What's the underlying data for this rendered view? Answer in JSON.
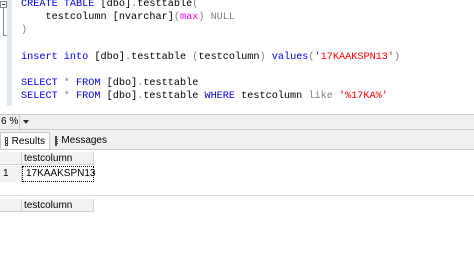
{
  "editor": {
    "lines": [
      {
        "parts": [
          {
            "t": "CREATE TABLE ",
            "c": "kw"
          },
          {
            "t": "[dbo]",
            "c": ""
          },
          {
            "t": ".",
            "c": "op"
          },
          {
            "t": "testtable",
            "c": ""
          },
          {
            "t": "(",
            "c": "op"
          }
        ]
      },
      {
        "parts": [
          {
            "t": "    testcolumn ",
            "c": ""
          },
          {
            "t": "[nvarchar]",
            "c": ""
          },
          {
            "t": "(",
            "c": "op"
          },
          {
            "t": "max",
            "c": "fn"
          },
          {
            "t": ")",
            "c": "op"
          },
          {
            "t": " ",
            "c": ""
          },
          {
            "t": "NULL",
            "c": "op"
          }
        ]
      },
      {
        "parts": [
          {
            "t": ")",
            "c": "op"
          }
        ]
      },
      {
        "parts": []
      },
      {
        "parts": [
          {
            "t": "insert into ",
            "c": "kw"
          },
          {
            "t": "[dbo]",
            "c": ""
          },
          {
            "t": ".",
            "c": "op"
          },
          {
            "t": "testtable ",
            "c": ""
          },
          {
            "t": "(",
            "c": "op"
          },
          {
            "t": "testcolumn",
            "c": ""
          },
          {
            "t": ")",
            "c": "op"
          },
          {
            "t": " ",
            "c": ""
          },
          {
            "t": "values",
            "c": "kw"
          },
          {
            "t": "(",
            "c": "op"
          },
          {
            "t": "'17KAAKSPN13'",
            "c": "str"
          },
          {
            "t": ")",
            "c": "op"
          }
        ]
      },
      {
        "parts": []
      },
      {
        "parts": [
          {
            "t": "SELECT ",
            "c": "kw"
          },
          {
            "t": "* ",
            "c": "op"
          },
          {
            "t": "FROM ",
            "c": "kw"
          },
          {
            "t": "[dbo]",
            "c": ""
          },
          {
            "t": ".",
            "c": "op"
          },
          {
            "t": "testtable",
            "c": ""
          }
        ]
      },
      {
        "parts": [
          {
            "t": "SELECT ",
            "c": "kw"
          },
          {
            "t": "* ",
            "c": "op"
          },
          {
            "t": "FROM ",
            "c": "kw"
          },
          {
            "t": "[dbo]",
            "c": ""
          },
          {
            "t": ".",
            "c": "op"
          },
          {
            "t": "testtable ",
            "c": ""
          },
          {
            "t": "WHERE ",
            "c": "kw"
          },
          {
            "t": "testcolumn ",
            "c": ""
          },
          {
            "t": "like ",
            "c": "op"
          },
          {
            "t": "'%17KA%'",
            "c": "str"
          }
        ]
      }
    ]
  },
  "zoom": {
    "value": "6 %"
  },
  "tabs": {
    "results_label": "Results",
    "messages_label": "Messages"
  },
  "grid1": {
    "column": "testcolumn",
    "rows": [
      {
        "num": "1",
        "value": "17KAAKSPN13"
      }
    ]
  },
  "grid2": {
    "column": "testcolumn"
  }
}
